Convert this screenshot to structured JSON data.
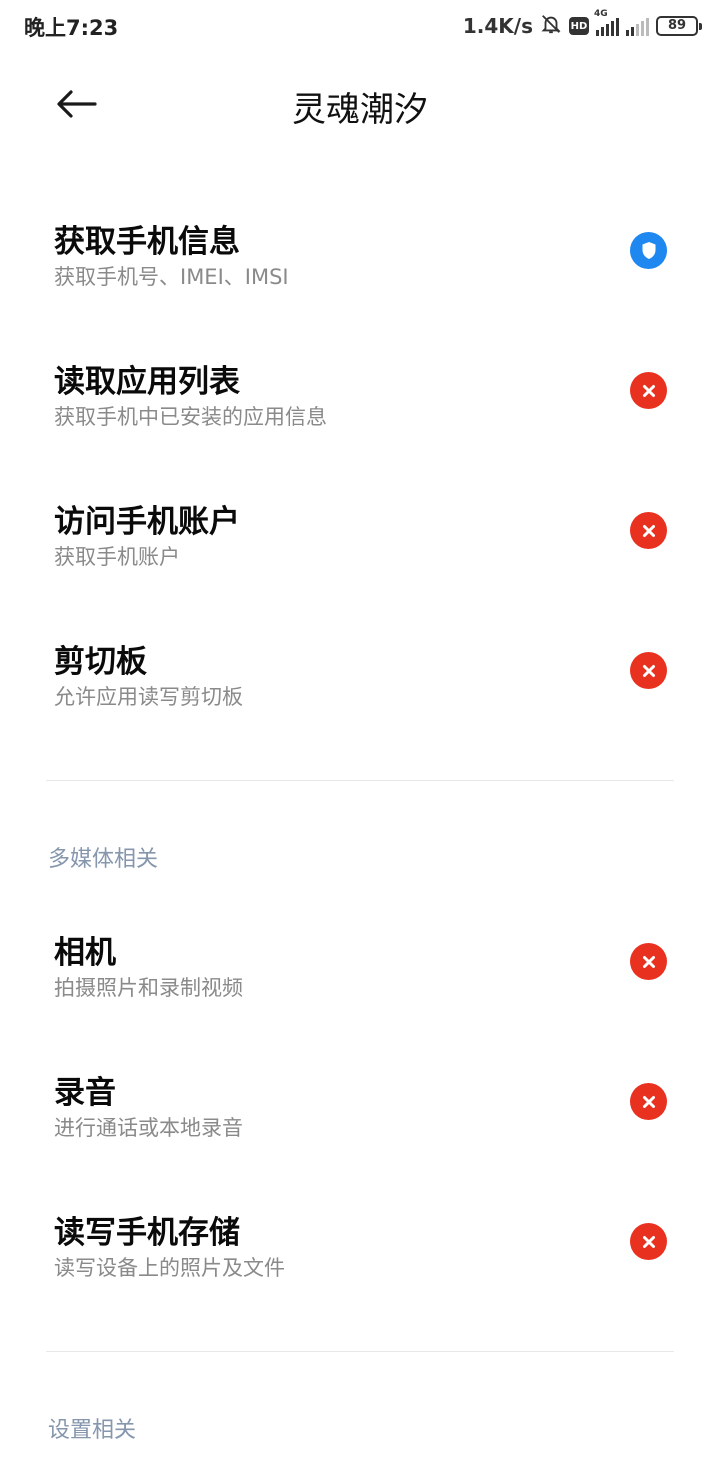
{
  "status_bar": {
    "time": "晚上7:23",
    "net_speed": "1.4K/s",
    "hd": "HD",
    "network_type": "4G",
    "battery": "89"
  },
  "header": {
    "title": "灵魂潮汐"
  },
  "sections": [
    {
      "items": [
        {
          "title": "获取手机信息",
          "desc": "获取手机号、IMEI、IMSI",
          "status": "allowed"
        },
        {
          "title": "读取应用列表",
          "desc": "获取手机中已安装的应用信息",
          "status": "denied"
        },
        {
          "title": "访问手机账户",
          "desc": "获取手机账户",
          "status": "denied"
        },
        {
          "title": "剪切板",
          "desc": "允许应用读写剪切板",
          "status": "denied"
        }
      ]
    },
    {
      "header": "多媒体相关",
      "items": [
        {
          "title": "相机",
          "desc": "拍摄照片和录制视频",
          "status": "denied"
        },
        {
          "title": "录音",
          "desc": "进行通话或本地录音",
          "status": "denied"
        },
        {
          "title": "读写手机存储",
          "desc": "读写设备上的照片及文件",
          "status": "denied"
        }
      ]
    },
    {
      "header": "设置相关"
    }
  ],
  "colors": {
    "allowed": "#1e88f0",
    "denied": "#e9311f",
    "section_header": "#8596ad"
  },
  "icons": {
    "allowed": "shield-icon",
    "denied": "x-icon"
  }
}
